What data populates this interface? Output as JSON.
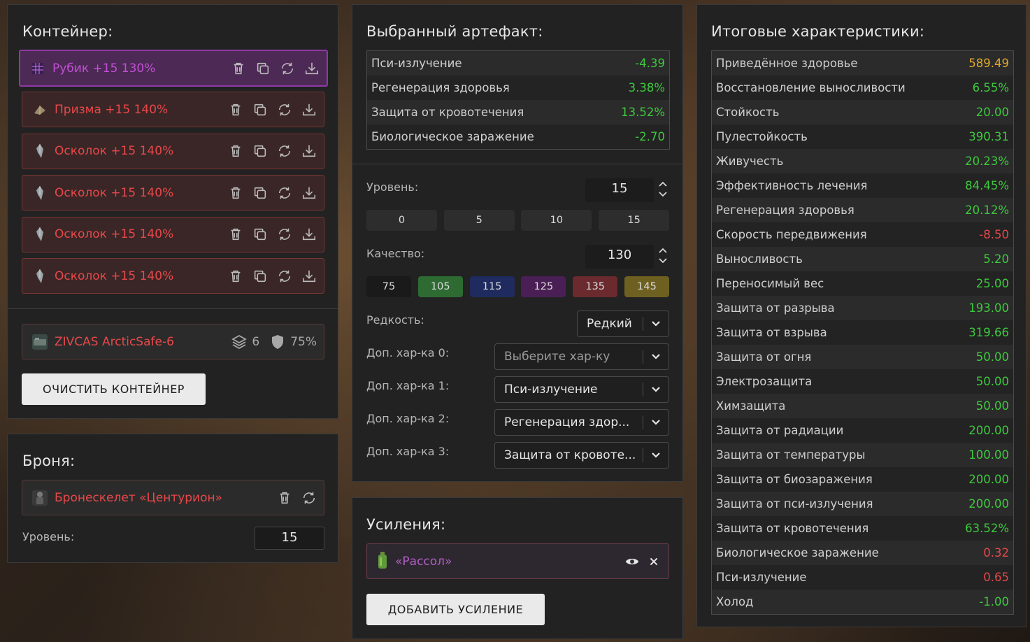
{
  "container": {
    "title": "Контейнер:",
    "artifacts": [
      {
        "name": "Рубик +15 130%",
        "selected": true,
        "thumb": "rubik-icon"
      },
      {
        "name": "Призма +15 140%",
        "selected": false,
        "thumb": "prism-icon"
      },
      {
        "name": "Осколок +15 140%",
        "selected": false,
        "thumb": "shard-icon"
      },
      {
        "name": "Осколок +15 140%",
        "selected": false,
        "thumb": "shard-icon"
      },
      {
        "name": "Осколок +15 140%",
        "selected": false,
        "thumb": "shard-icon"
      },
      {
        "name": "Осколок +15 140%",
        "selected": false,
        "thumb": "shard-icon"
      }
    ],
    "item": {
      "name": "ZIVCAS ArcticSafe-6",
      "slots": "6",
      "protection": "75%"
    },
    "clear_label": "ОЧИСТИТЬ КОНТЕЙНЕР"
  },
  "armor": {
    "title": "Броня:",
    "name": "Бронескелет «Центурион»",
    "level_label": "Уровень:",
    "level_value": "15"
  },
  "artifact": {
    "title": "Выбранный артефакт:",
    "stats": [
      {
        "name": "Пси-излучение",
        "value": "-4.39",
        "color": "green"
      },
      {
        "name": "Регенерация здоровья",
        "value": "3.38%",
        "color": "green"
      },
      {
        "name": "Защита от кровотечения",
        "value": "13.52%",
        "color": "green"
      },
      {
        "name": "Биологическое заражение",
        "value": "-2.70",
        "color": "green"
      }
    ],
    "level_label": "Уровень:",
    "level_value": "15",
    "level_presets": [
      "0",
      "5",
      "10",
      "15"
    ],
    "quality_label": "Качество:",
    "quality_value": "130",
    "quality_presets": [
      {
        "label": "75",
        "color": "#1a1a1a"
      },
      {
        "label": "105",
        "color": "#2e6b33"
      },
      {
        "label": "115",
        "color": "#1f2a5e"
      },
      {
        "label": "125",
        "color": "#4a1f55"
      },
      {
        "label": "135",
        "color": "#6a2a2e"
      },
      {
        "label": "145",
        "color": "#6e6020"
      }
    ],
    "rarity_label": "Редкость:",
    "rarity_value": "Редкий",
    "extra_stats": [
      {
        "label": "Доп. хар-ка 0:",
        "value": "Выберите хар-ку",
        "placeholder": true
      },
      {
        "label": "Доп. хар-ка 1:",
        "value": "Пси-излучение",
        "placeholder": false
      },
      {
        "label": "Доп. хар-ка 2:",
        "value": "Регенерация здор...",
        "placeholder": false
      },
      {
        "label": "Доп. хар-ка 3:",
        "value": "Защита от кровоте...",
        "placeholder": false
      }
    ]
  },
  "boosts": {
    "title": "Усиления:",
    "items": [
      {
        "name": "«Рассол»"
      }
    ],
    "add_label": "ДОБАВИТЬ УСИЛЕНИЕ"
  },
  "totals": {
    "title": "Итоговые характеристики:",
    "stats": [
      {
        "name": "Приведённое здоровье",
        "value": "589.49",
        "color": "gold"
      },
      {
        "name": "Восстановление выносливости",
        "value": "6.55%",
        "color": "green"
      },
      {
        "name": "Стойкость",
        "value": "20.00",
        "color": "green"
      },
      {
        "name": "Пулестойкость",
        "value": "390.31",
        "color": "green"
      },
      {
        "name": "Живучесть",
        "value": "20.23%",
        "color": "green"
      },
      {
        "name": "Эффективность лечения",
        "value": "84.45%",
        "color": "green"
      },
      {
        "name": "Регенерация здоровья",
        "value": "20.12%",
        "color": "green"
      },
      {
        "name": "Скорость передвижения",
        "value": "-8.50",
        "color": "red"
      },
      {
        "name": "Выносливость",
        "value": "5.20",
        "color": "green"
      },
      {
        "name": "Переносимый вес",
        "value": "25.00",
        "color": "green"
      },
      {
        "name": "Защита от разрыва",
        "value": "193.00",
        "color": "green"
      },
      {
        "name": "Защита от взрыва",
        "value": "319.66",
        "color": "green"
      },
      {
        "name": "Защита от огня",
        "value": "50.00",
        "color": "green"
      },
      {
        "name": "Электрозащита",
        "value": "50.00",
        "color": "green"
      },
      {
        "name": "Химзащита",
        "value": "50.00",
        "color": "green"
      },
      {
        "name": "Защита от радиации",
        "value": "200.00",
        "color": "green"
      },
      {
        "name": "Защита от температуры",
        "value": "100.00",
        "color": "green"
      },
      {
        "name": "Защита от биозаражения",
        "value": "200.00",
        "color": "green"
      },
      {
        "name": "Защита от пси-излучения",
        "value": "200.00",
        "color": "green"
      },
      {
        "name": "Защита от кровотечения",
        "value": "63.52%",
        "color": "green"
      },
      {
        "name": "Биологическое заражение",
        "value": "0.32",
        "color": "red"
      },
      {
        "name": "Пси-излучение",
        "value": "0.65",
        "color": "red"
      },
      {
        "name": "Холод",
        "value": "-1.00",
        "color": "green"
      }
    ]
  }
}
